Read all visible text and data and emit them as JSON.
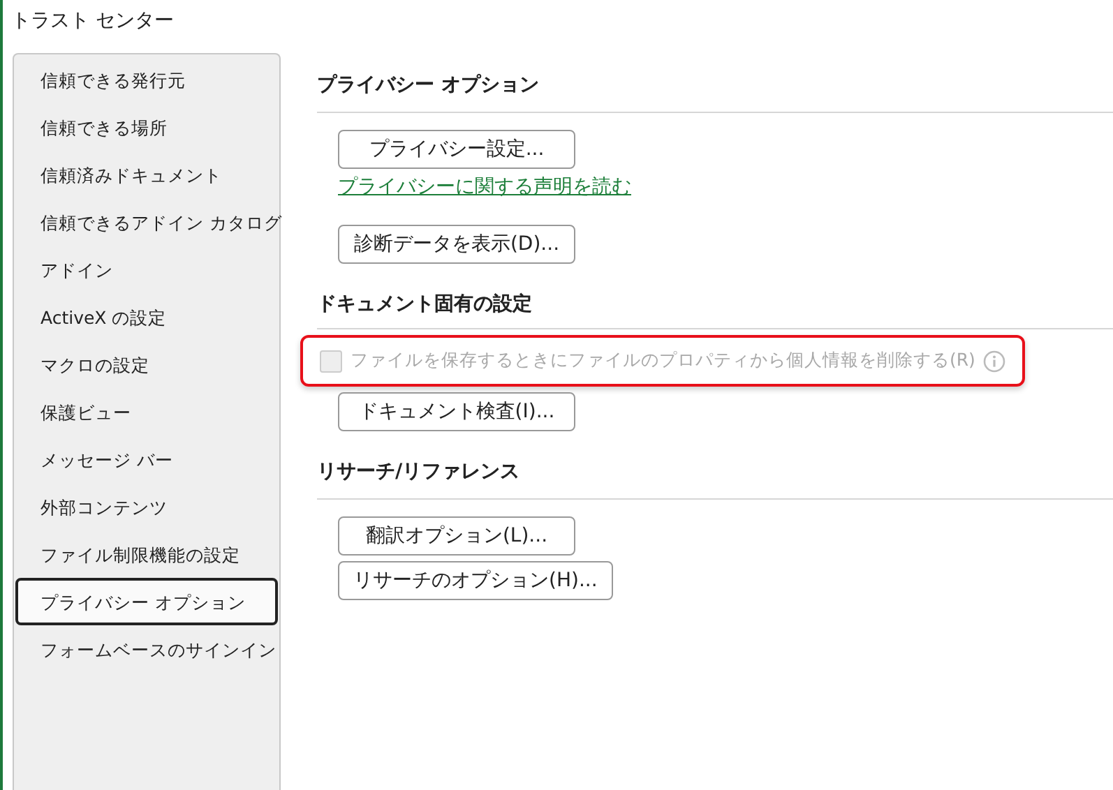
{
  "window": {
    "title": "トラスト センター"
  },
  "sidebar": {
    "items": [
      {
        "label": "信頼できる発行元",
        "selected": false
      },
      {
        "label": "信頼できる場所",
        "selected": false
      },
      {
        "label": "信頼済みドキュメント",
        "selected": false
      },
      {
        "label": "信頼できるアドイン カタログ",
        "selected": false
      },
      {
        "label": "アドイン",
        "selected": false
      },
      {
        "label": "ActiveX の設定",
        "selected": false
      },
      {
        "label": "マクロの設定",
        "selected": false
      },
      {
        "label": "保護ビュー",
        "selected": false
      },
      {
        "label": "メッセージ バー",
        "selected": false
      },
      {
        "label": "外部コンテンツ",
        "selected": false
      },
      {
        "label": "ファイル制限機能の設定",
        "selected": false
      },
      {
        "label": "プライバシー オプション",
        "selected": true
      },
      {
        "label": "フォームベースのサインイン",
        "selected": false
      }
    ]
  },
  "sections": [
    {
      "heading": "プライバシー オプション",
      "items": [
        {
          "kind": "button",
          "label": "プライバシー設定..."
        },
        {
          "kind": "link",
          "label": "プライバシーに関する声明を読む"
        },
        {
          "kind": "button",
          "label": "診断データを表示(D)..."
        }
      ]
    },
    {
      "heading": "ドキュメント固有の設定",
      "items": [
        {
          "kind": "checkbox",
          "label": "ファイルを保存するときにファイルのプロパティから個人情報を削除する(R)",
          "checked": false,
          "disabled": true,
          "highlighted": true
        },
        {
          "kind": "button",
          "label": "ドキュメント検査(I)..."
        }
      ]
    },
    {
      "heading": "リサーチ/リファレンス",
      "items": [
        {
          "kind": "button",
          "label": "翻訳オプション(L)..."
        },
        {
          "kind": "button",
          "label": "リサーチのオプション(H)..."
        }
      ]
    }
  ]
}
